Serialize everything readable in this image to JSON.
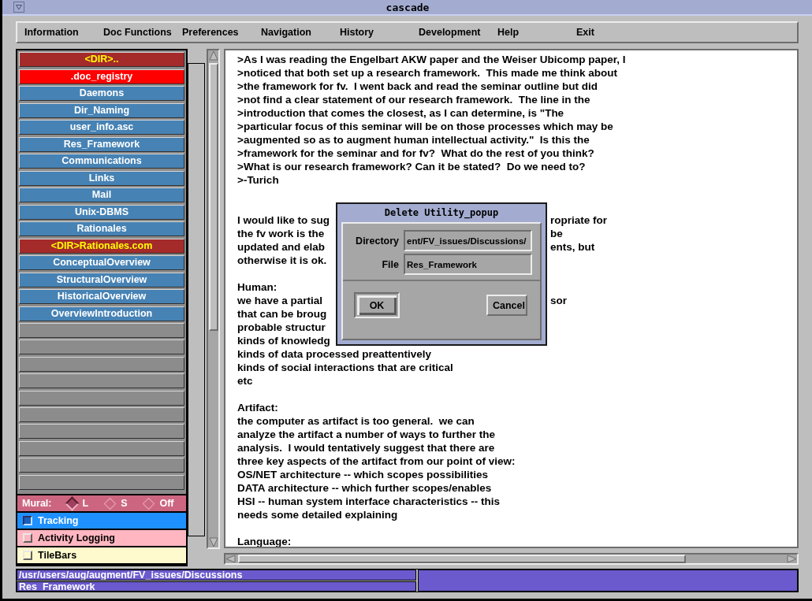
{
  "window": {
    "title": "cascade"
  },
  "menu": [
    "Information",
    "Doc Functions",
    "Preferences",
    "Navigation",
    "History",
    "Development",
    "Help",
    "Exit"
  ],
  "file_list": {
    "items": [
      {
        "label": "<DIR>..",
        "kind": "dir",
        "selected": false
      },
      {
        "label": ".doc_registry",
        "kind": "file",
        "selected": true
      },
      {
        "label": "Daemons",
        "kind": "file",
        "selected": false
      },
      {
        "label": "Dir_Naming",
        "kind": "file",
        "selected": false
      },
      {
        "label": "user_info.asc",
        "kind": "file",
        "selected": false
      },
      {
        "label": "Res_Framework",
        "kind": "file",
        "selected": false
      },
      {
        "label": "Communications",
        "kind": "file",
        "selected": false
      },
      {
        "label": "Links",
        "kind": "file",
        "selected": false
      },
      {
        "label": "Mail",
        "kind": "file",
        "selected": false
      },
      {
        "label": "Unix-DBMS",
        "kind": "file",
        "selected": false
      },
      {
        "label": "Rationales",
        "kind": "file",
        "selected": false
      },
      {
        "label": "<DIR>Rationales.com",
        "kind": "dir",
        "selected": false
      },
      {
        "label": "ConceptualOverview",
        "kind": "file",
        "selected": false
      },
      {
        "label": "StructuralOverview",
        "kind": "file",
        "selected": false
      },
      {
        "label": "HistoricalOverview",
        "kind": "file",
        "selected": false
      },
      {
        "label": "OverviewIntroduction",
        "kind": "file",
        "selected": false
      }
    ]
  },
  "options": {
    "mural": {
      "label": "Mural:",
      "choices": [
        {
          "label": "L",
          "selected": true
        },
        {
          "label": "S",
          "selected": false
        },
        {
          "label": "Off",
          "selected": false
        }
      ]
    },
    "toggles": [
      {
        "label": "Tracking",
        "checked": true,
        "color": "#1e90ff"
      },
      {
        "label": "Activity Logging",
        "checked": false,
        "color": "#ffb6c1"
      },
      {
        "label": "TileBars",
        "checked": false,
        "color": "#fffacd"
      }
    ]
  },
  "document": {
    "paragraphs": [
      {
        "kind": "quote",
        "lines": [
          {
            "text": ">As I was reading the Engelbart AKW paper and the Weiser Ubicomp paper, I"
          },
          {
            "text": ">noticed that both set up a research framework.  This made me think about"
          },
          {
            "text": ">the framework for fv.  I went back and read the seminar outline but did"
          },
          {
            "text": ">not find a clear statement of our research framework.  The line in the"
          },
          {
            "text": ">introduction that comes the closest, as I can determine, is \"The"
          },
          {
            "text": ">particular focus of this seminar will be on those processes which may be"
          },
          {
            "text": ">augmented so as to augment human intellectual activity.\"  Is this the"
          },
          {
            "text": ">framework for the seminar and for fv?  What do the rest of you think?"
          },
          {
            "text": ">What is our research framework? Can it be stated?  Do we need to?"
          },
          {
            "text": ">-Turich"
          }
        ]
      },
      {
        "kind": "body",
        "lines": [
          {
            "text": "I would like to sug",
            "right": "ropriate for"
          },
          {
            "text": "the fv work is the",
            "right": "be"
          },
          {
            "text": "updated and elab",
            "right": "ents, but"
          },
          {
            "text": "otherwise it is ok."
          }
        ]
      },
      {
        "kind": "body",
        "lines": [
          {
            "text": "Human:"
          },
          {
            "text": "we have a partial",
            "right": "sor"
          },
          {
            "text": "that can be broug"
          },
          {
            "text": "probable structur"
          },
          {
            "text": "kinds of knowledg"
          },
          {
            "text": "kinds of data processed preattentively"
          },
          {
            "text": "kinds of social interactions that are critical"
          },
          {
            "text": "etc"
          }
        ]
      },
      {
        "kind": "body",
        "lines": [
          {
            "text": "Artifact:"
          },
          {
            "text": "the computer as artifact is too general.  we can"
          },
          {
            "text": "analyze the artifact a number of ways to further the"
          },
          {
            "text": "analysis.  I would tentatively suggest that there are"
          },
          {
            "text": "three key aspects of the artifact from our point of view:"
          },
          {
            "text": "OS/NET architecture -- which scopes possibilities"
          },
          {
            "text": "DATA architecture -- which further scopes/enables"
          },
          {
            "text": "HSI -- human system interface characteristics -- this"
          },
          {
            "text": "needs some detailed explaining"
          }
        ]
      },
      {
        "kind": "body",
        "lines": [
          {
            "text": "Language:"
          }
        ]
      }
    ]
  },
  "dialog": {
    "title": "Delete Utility_popup",
    "fields": [
      {
        "label": "Directory",
        "value": "ent/FV_issues/Discussions/"
      },
      {
        "label": "File",
        "value": "Res_Framework"
      }
    ],
    "buttons": [
      {
        "label": "OK",
        "default": true
      },
      {
        "label": "Cancel",
        "default": false
      }
    ]
  },
  "status_bar": {
    "path": "/usr/users/aug/augment/FV_issues/Discussions",
    "file": "Res_Framework"
  }
}
